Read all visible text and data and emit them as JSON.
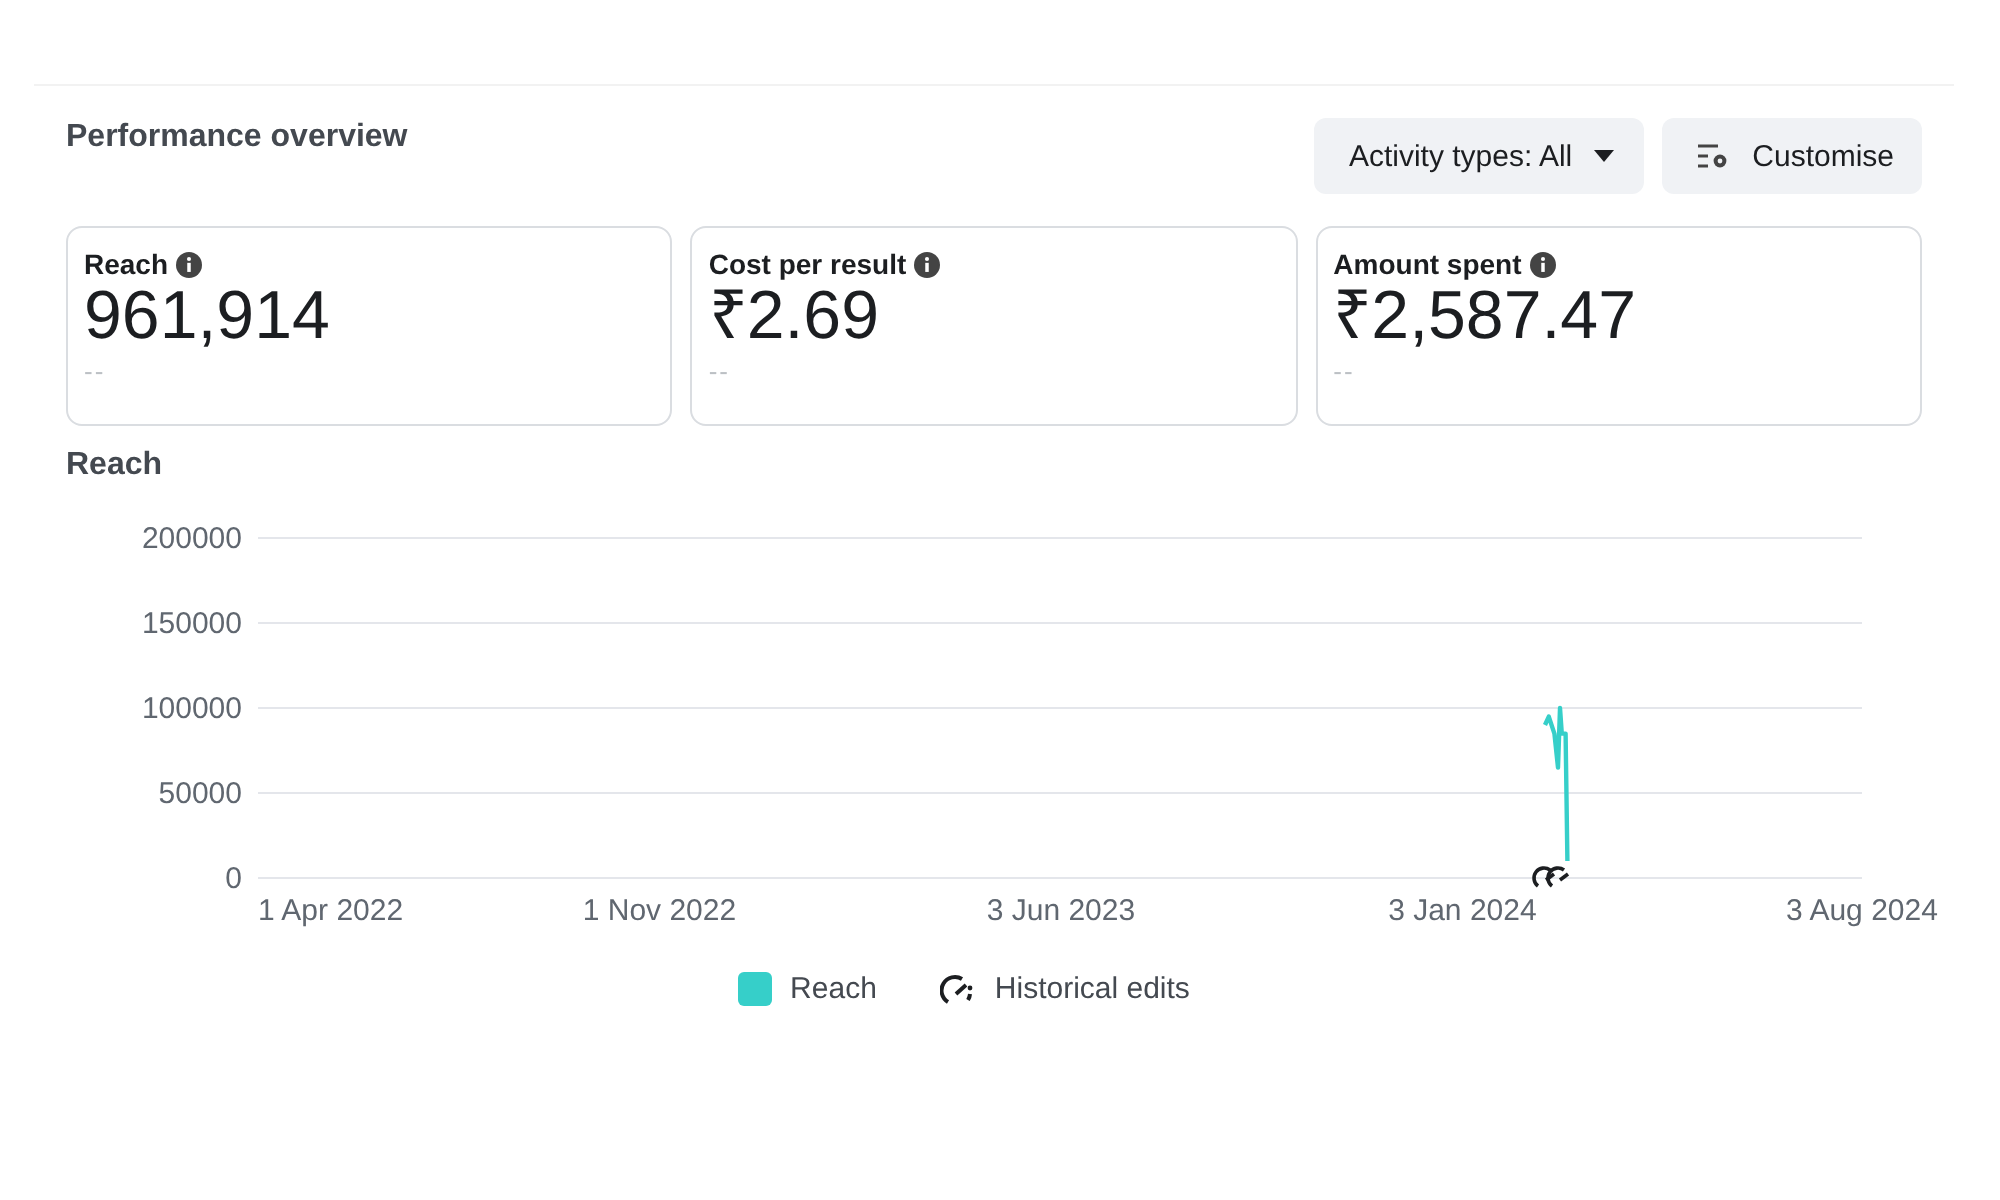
{
  "title": "Performance overview",
  "filter_button": {
    "label": "Activity types: All"
  },
  "customise_button": {
    "label": "Customise"
  },
  "metrics": [
    {
      "label": "Reach",
      "value": "961,914",
      "comparison": "--"
    },
    {
      "label": "Cost per result",
      "value": "₹2.69",
      "comparison": "--"
    },
    {
      "label": "Amount spent",
      "value": "₹2,587.47",
      "comparison": "--"
    }
  ],
  "chart": {
    "title": "Reach",
    "chart_data": {
      "type": "line",
      "x": [
        "2024-02-16",
        "2024-02-18",
        "2024-02-21",
        "2024-02-23",
        "2024-02-24",
        "2024-02-25",
        "2024-02-27",
        "2024-02-28"
      ],
      "series": [
        {
          "name": "Reach",
          "color": "#36cfc9",
          "values": [
            90000,
            95000,
            85000,
            65000,
            100000,
            85000,
            85000,
            10000
          ]
        }
      ],
      "grid": true,
      "xlim": [
        "2022-04-01",
        "2024-08-03"
      ],
      "ylim": [
        0,
        200000
      ],
      "xticks": [
        {
          "value": "2022-04-01",
          "label": "1 Apr 2022"
        },
        {
          "value": "2022-11-01",
          "label": "1 Nov 2022"
        },
        {
          "value": "2023-06-03",
          "label": "3 Jun 2023"
        },
        {
          "value": "2024-01-03",
          "label": "3 Jan 2024"
        },
        {
          "value": "2024-08-03",
          "label": "3 Aug 2024"
        }
      ],
      "yticks": [
        0,
        50000,
        100000,
        150000,
        200000
      ]
    },
    "legend": [
      {
        "kind": "edits",
        "label": "Historical edits"
      }
    ]
  }
}
